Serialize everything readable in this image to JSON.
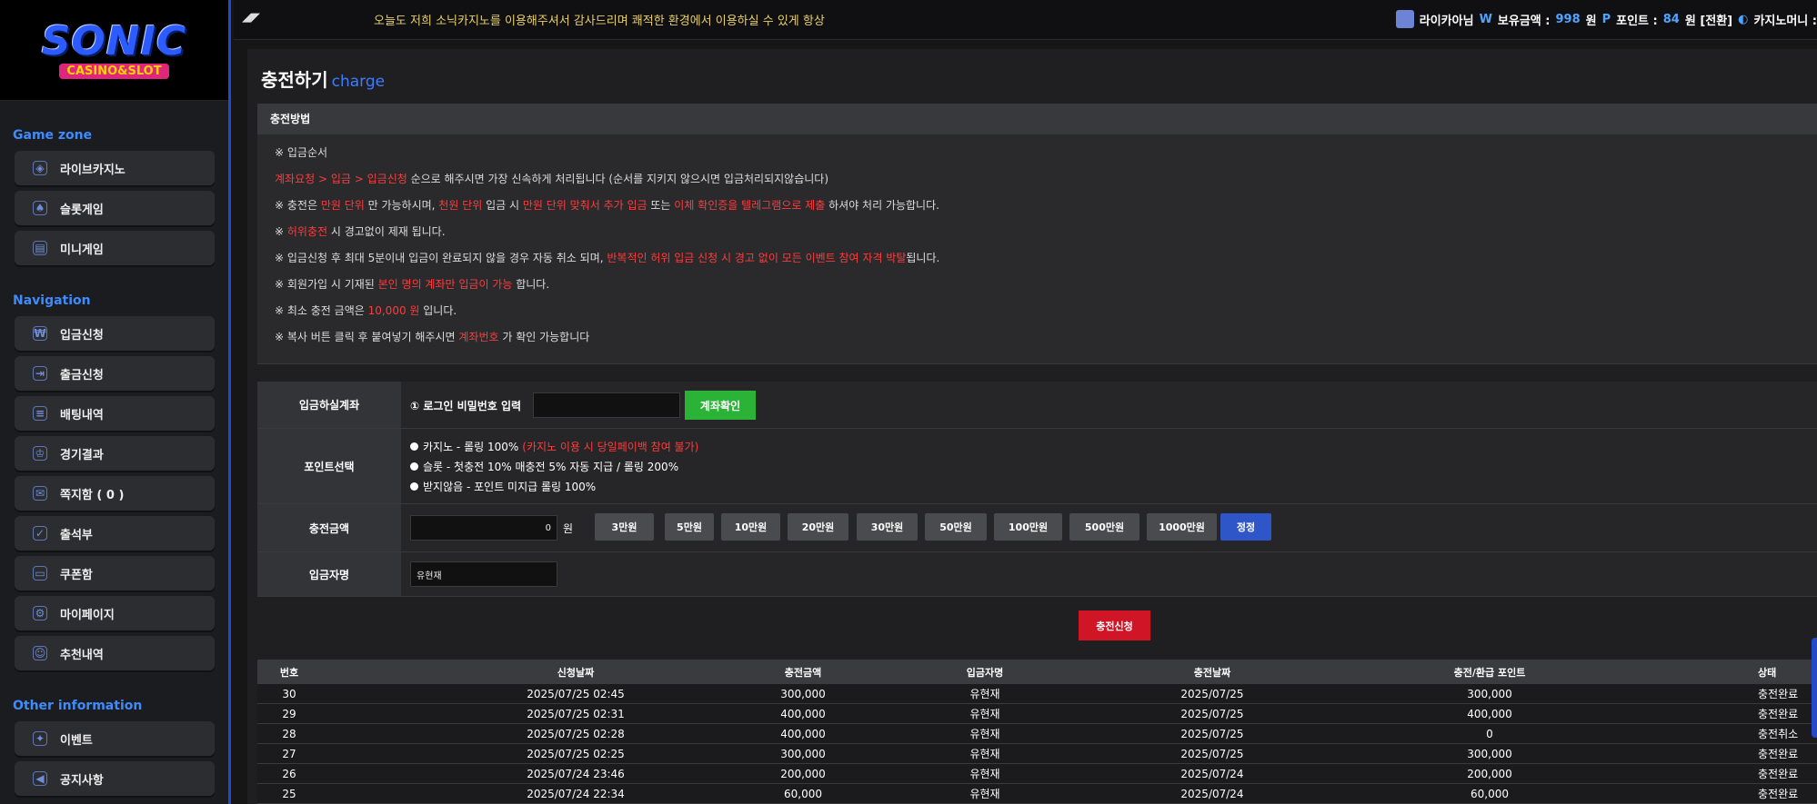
{
  "brand": {
    "logo_main": "SONIC",
    "logo_sub": "CASINO&SLOT"
  },
  "sidebar": {
    "sections": [
      {
        "title": "Game zone",
        "items": [
          {
            "label": "라이브카지노",
            "icon": "dice-icon"
          },
          {
            "label": "슬롯게임",
            "icon": "slot-icon"
          },
          {
            "label": "미니게임",
            "icon": "mini-game-icon"
          }
        ]
      },
      {
        "title": "Navigation",
        "items": [
          {
            "label": "입금신청",
            "icon": "deposit-icon"
          },
          {
            "label": "출금신청",
            "icon": "withdraw-icon"
          },
          {
            "label": "배팅내역",
            "icon": "bet-history-icon"
          },
          {
            "label": "경기결과",
            "icon": "result-icon"
          },
          {
            "label": "쪽지함 ( 0 )",
            "icon": "message-icon"
          },
          {
            "label": "출석부",
            "icon": "attendance-icon"
          },
          {
            "label": "쿠폰함",
            "icon": "coupon-icon"
          },
          {
            "label": "마이페이지",
            "icon": "gear-icon"
          },
          {
            "label": "추천내역",
            "icon": "referral-icon"
          }
        ]
      },
      {
        "title": "Other information",
        "items": [
          {
            "label": "이벤트",
            "icon": "gift-icon"
          },
          {
            "label": "공지사항",
            "icon": "megaphone-icon"
          }
        ]
      }
    ]
  },
  "topbar": {
    "marquee": "오늘도 저희 소닉카지노를 이용해주셔서 감사드리며 쾌적한 환경에서 이용하실 수 있게 항상",
    "username": "라이카아님",
    "balance_prefix": "W",
    "balance_label": "보유금액 :",
    "balance_value": "998",
    "balance_unit": "원",
    "point_prefix": "P",
    "point_label": "포인트 :",
    "point_value": "84",
    "point_unit": "원 [전환]",
    "casino_money": "카지노머니 :"
  },
  "page": {
    "title": "충전하기",
    "subtitle": "charge"
  },
  "method": {
    "heading": "충전방법",
    "lines": [
      [
        {
          "t": "※ 입금순서",
          "red": false
        }
      ],
      [
        {
          "t": "계좌요청 > 입금 > 입금신청",
          "red": true
        },
        {
          "t": " 순으로 해주시면 가장 신속하게 처리됩니다 (순서를 지키지 않으시면 입금처리되지않습니다)",
          "red": false
        }
      ],
      [
        {
          "t": "※ 충전은 ",
          "red": false
        },
        {
          "t": "만원 단위",
          "red": true
        },
        {
          "t": " 만 가능하시며, ",
          "red": false
        },
        {
          "t": "천원 단위",
          "red": true
        },
        {
          "t": " 입금 시 ",
          "red": false
        },
        {
          "t": "만원 단위 맞춰서 추가 입금",
          "red": true
        },
        {
          "t": " 또는 ",
          "red": false
        },
        {
          "t": "이체 확인증을 텔레그램으로 제출",
          "red": true
        },
        {
          "t": " 하셔야 처리 가능합니다.",
          "red": false
        }
      ],
      [
        {
          "t": "※ ",
          "red": false
        },
        {
          "t": "허위충전",
          "red": true
        },
        {
          "t": " 시 경고없이 제재 됩니다.",
          "red": false
        }
      ],
      [
        {
          "t": "※ 입금신청 후 최대 5분이내 입금이 완료되지 않을 경우 자동 취소 되며, ",
          "red": false
        },
        {
          "t": "반복적인 허위 입금 신청 시 경고 없이 모든 이벤트 참여 자격 박탈",
          "red": true
        },
        {
          "t": "됩니다.",
          "red": false
        }
      ],
      [
        {
          "t": "※ 회원가입 시 기재된 ",
          "red": false
        },
        {
          "t": "본인 명의 계좌만 입금이 가능",
          "red": true
        },
        {
          "t": " 합니다.",
          "red": false
        }
      ],
      [
        {
          "t": "※ 최소 충전 금액은 ",
          "red": false
        },
        {
          "t": "10,000 원",
          "red": true
        },
        {
          "t": " 입니다.",
          "red": false
        }
      ],
      [
        {
          "t": "※ 복사 버튼 클릭 후 붙여넣기 해주시면 ",
          "red": false
        },
        {
          "t": "계좌번호",
          "red": true
        },
        {
          "t": " 가 확인 가능합니다",
          "red": false
        }
      ]
    ]
  },
  "form": {
    "account_label": "입금하실계좌",
    "password_prompt": "① 로그인 비밀번호 입력",
    "password_value": "",
    "account_check_btn": "계좌확인",
    "point_label": "포인트선택",
    "point_options": [
      {
        "text": "카지노 - 롤링 100%",
        "note": "(카지노 이용 시 당일페이백 참여 불가)"
      },
      {
        "text": "슬롯 - 첫충전 10% 매충전 5% 자동 지급 / 롤링 200%",
        "note": ""
      },
      {
        "text": "받지않음 - 포인트 미지급 롤링 100%",
        "note": ""
      }
    ],
    "amount_label": "충전금액",
    "amount_value": "0",
    "amount_unit": "원",
    "amount_buttons": [
      "3만원",
      "5만원",
      "10만원",
      "20만원",
      "30만원",
      "50만원",
      "100만원",
      "500만원",
      "1000만원"
    ],
    "reset_btn": "정정",
    "depositor_label": "입금자명",
    "depositor_value": "유현재",
    "submit": "충전신청"
  },
  "history": {
    "columns": [
      "번호",
      "신청날짜",
      "충전금액",
      "입금자명",
      "충전날짜",
      "충전/환급 포인트",
      "상태"
    ],
    "rows": [
      [
        "30",
        "2025/07/25 02:45",
        "300,000",
        "유현재",
        "2025/07/25",
        "300,000",
        "충전완료"
      ],
      [
        "29",
        "2025/07/25 02:31",
        "400,000",
        "유현재",
        "2025/07/25",
        "400,000",
        "충전완료"
      ],
      [
        "28",
        "2025/07/25 02:28",
        "400,000",
        "유현재",
        "2025/07/25",
        "0",
        "충전취소"
      ],
      [
        "27",
        "2025/07/25 02:25",
        "300,000",
        "유현재",
        "2025/07/25",
        "300,000",
        "충전완료"
      ],
      [
        "26",
        "2025/07/24 23:46",
        "200,000",
        "유현재",
        "2025/07/24",
        "200,000",
        "충전완료"
      ],
      [
        "25",
        "2025/07/24 22:34",
        "60,000",
        "유현재",
        "2025/07/24",
        "60,000",
        "충전완료"
      ]
    ]
  },
  "colors": {
    "accent_blue": "#2549c9",
    "warning_red": "#ff3b3b",
    "confirm_green": "#2bb338",
    "submit_red": "#d01527"
  }
}
